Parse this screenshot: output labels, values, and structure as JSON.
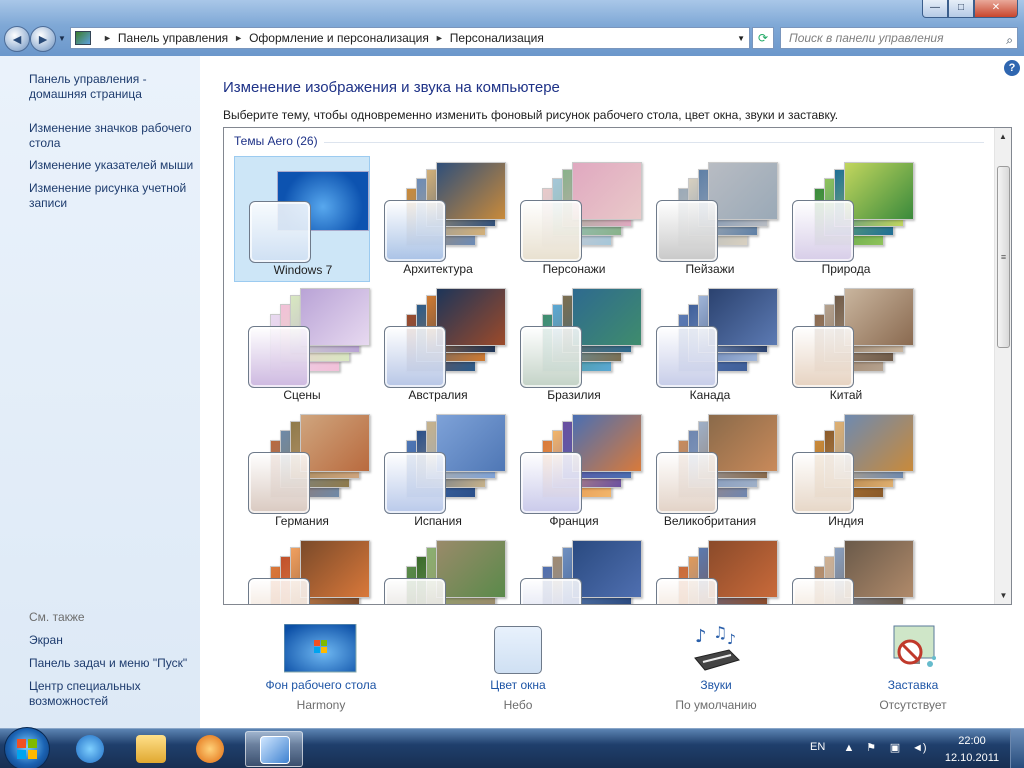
{
  "window": {
    "controls": {
      "minimize": "—",
      "maximize": "□",
      "close": "✕"
    }
  },
  "address_bar": {
    "crumbs": [
      "Панель управления",
      "Оформление и персонализация",
      "Персонализация"
    ],
    "search_placeholder": "Поиск в панели управления"
  },
  "left_pane": {
    "links": [
      "Панель управления - домашняя страница",
      "Изменение значков рабочего стола",
      "Изменение указателей мыши",
      "Изменение рисунка учетной записи"
    ],
    "see_also_label": "См. также",
    "see_also": [
      "Экран",
      "Панель задач и меню \"Пуск\"",
      "Центр специальных возможностей"
    ]
  },
  "main": {
    "title": "Изменение изображения и звука на компьютере",
    "description": "Выберите тему, чтобы одновременно изменить фоновый рисунок рабочего стола, цвет окна, звуки и заставку.",
    "group_header": "Темы Aero (26)",
    "themes": [
      {
        "name": "Windows 7",
        "selected": true,
        "swatch": "#cfe0f3",
        "colors": [
          "#1b64c4",
          "#4aa0ea",
          "#2a7ad5",
          "#0d4ea8"
        ]
      },
      {
        "name": "Архитектура",
        "swatch": "#a9c2e6",
        "colors": [
          "#c98a3a",
          "#6b8bb7",
          "#d3b078",
          "#2f4f7a"
        ]
      },
      {
        "name": "Персонажи",
        "swatch": "#e8e0cf",
        "colors": [
          "#e9c9c9",
          "#a5c7d9",
          "#89b28a",
          "#e0a8c0"
        ]
      },
      {
        "name": "Пейзажи",
        "swatch": "#c8c8c8",
        "colors": [
          "#9aa9b7",
          "#d8d0c0",
          "#5e7fa6",
          "#b8bcc3"
        ]
      },
      {
        "name": "Природа",
        "swatch": "#d7cde8",
        "colors": [
          "#3a8a3c",
          "#8fc35a",
          "#1f6f96",
          "#c2d65e"
        ]
      },
      {
        "name": "Сцены",
        "swatch": "#cdb8e0",
        "colors": [
          "#e7d9f0",
          "#f2c0d8",
          "#d8e8c0",
          "#b9a3d6"
        ]
      },
      {
        "name": "Австралия",
        "swatch": "#b7c6e6",
        "colors": [
          "#9c4a2a",
          "#2a5c8c",
          "#d07a30",
          "#1d3559"
        ]
      },
      {
        "name": "Бразилия",
        "swatch": "#c3d2c6",
        "colors": [
          "#3f8c6d",
          "#5aa8d4",
          "#7c6e50",
          "#2e6a8f"
        ]
      },
      {
        "name": "Канада",
        "swatch": "#c6cce8",
        "colors": [
          "#5c7ab3",
          "#3f5f9a",
          "#a0b5d8",
          "#2b426f"
        ]
      },
      {
        "name": "Китай",
        "swatch": "#e6d2c0",
        "colors": [
          "#8a6a50",
          "#b5a28f",
          "#6f5a47",
          "#c9b59e"
        ]
      },
      {
        "name": "Германия",
        "swatch": "#d9c9c0",
        "colors": [
          "#b96a3e",
          "#6e8aa8",
          "#8f7a4a",
          "#cfa57e"
        ]
      },
      {
        "name": "Испания",
        "swatch": "#b9c9ea",
        "colors": [
          "#4f77b5",
          "#2a4f8a",
          "#c7b28a",
          "#7ea2d8"
        ]
      },
      {
        "name": "Франция",
        "swatch": "#c9c9ea",
        "colors": [
          "#d97a3a",
          "#f2b66a",
          "#6a4fa0",
          "#4a6fb3"
        ]
      },
      {
        "name": "Великобритания",
        "swatch": "#e2d2c6",
        "colors": [
          "#c98a5a",
          "#6e86b0",
          "#9fb0c8",
          "#8a6a4a"
        ]
      },
      {
        "name": "Индия",
        "swatch": "#e6d6c6",
        "colors": [
          "#c98a3a",
          "#8a5a2a",
          "#e0b070",
          "#6e8ab0"
        ]
      },
      {
        "name": "",
        "swatch": "#ead6c6",
        "colors": [
          "#d9783a",
          "#c0502a",
          "#f0a060",
          "#7a4a2a"
        ]
      },
      {
        "name": "",
        "swatch": "#d6d2cc",
        "colors": [
          "#5a8a4a",
          "#3a6a2a",
          "#8ab070",
          "#9a8a6a"
        ]
      },
      {
        "name": "",
        "swatch": "#cdd2ea",
        "colors": [
          "#4f6fb0",
          "#a08a70",
          "#7090c0",
          "#2a4a80"
        ]
      },
      {
        "name": "",
        "swatch": "#ead6c6",
        "colors": [
          "#c96a3a",
          "#e09a5a",
          "#5a7ab0",
          "#8a4a2a"
        ]
      },
      {
        "name": "",
        "swatch": "#ead8c6",
        "colors": [
          "#b08a6a",
          "#d0b090",
          "#8aa0c0",
          "#6a5a4a"
        ]
      }
    ]
  },
  "bottom": [
    {
      "title": "Фон рабочего стола",
      "value": "Harmony",
      "icon": "wallpaper-icon"
    },
    {
      "title": "Цвет окна",
      "value": "Небо",
      "icon": "window-color-icon"
    },
    {
      "title": "Звуки",
      "value": "По умолчанию",
      "icon": "sounds-icon"
    },
    {
      "title": "Заставка",
      "value": "Отсутствует",
      "icon": "screensaver-icon"
    }
  ],
  "taskbar": {
    "language": "EN",
    "time": "22:00",
    "date": "12.10.2011",
    "apps": [
      "Internet Explorer",
      "Проводник",
      "Проигрыватель Windows Media",
      "Панель управления"
    ]
  }
}
